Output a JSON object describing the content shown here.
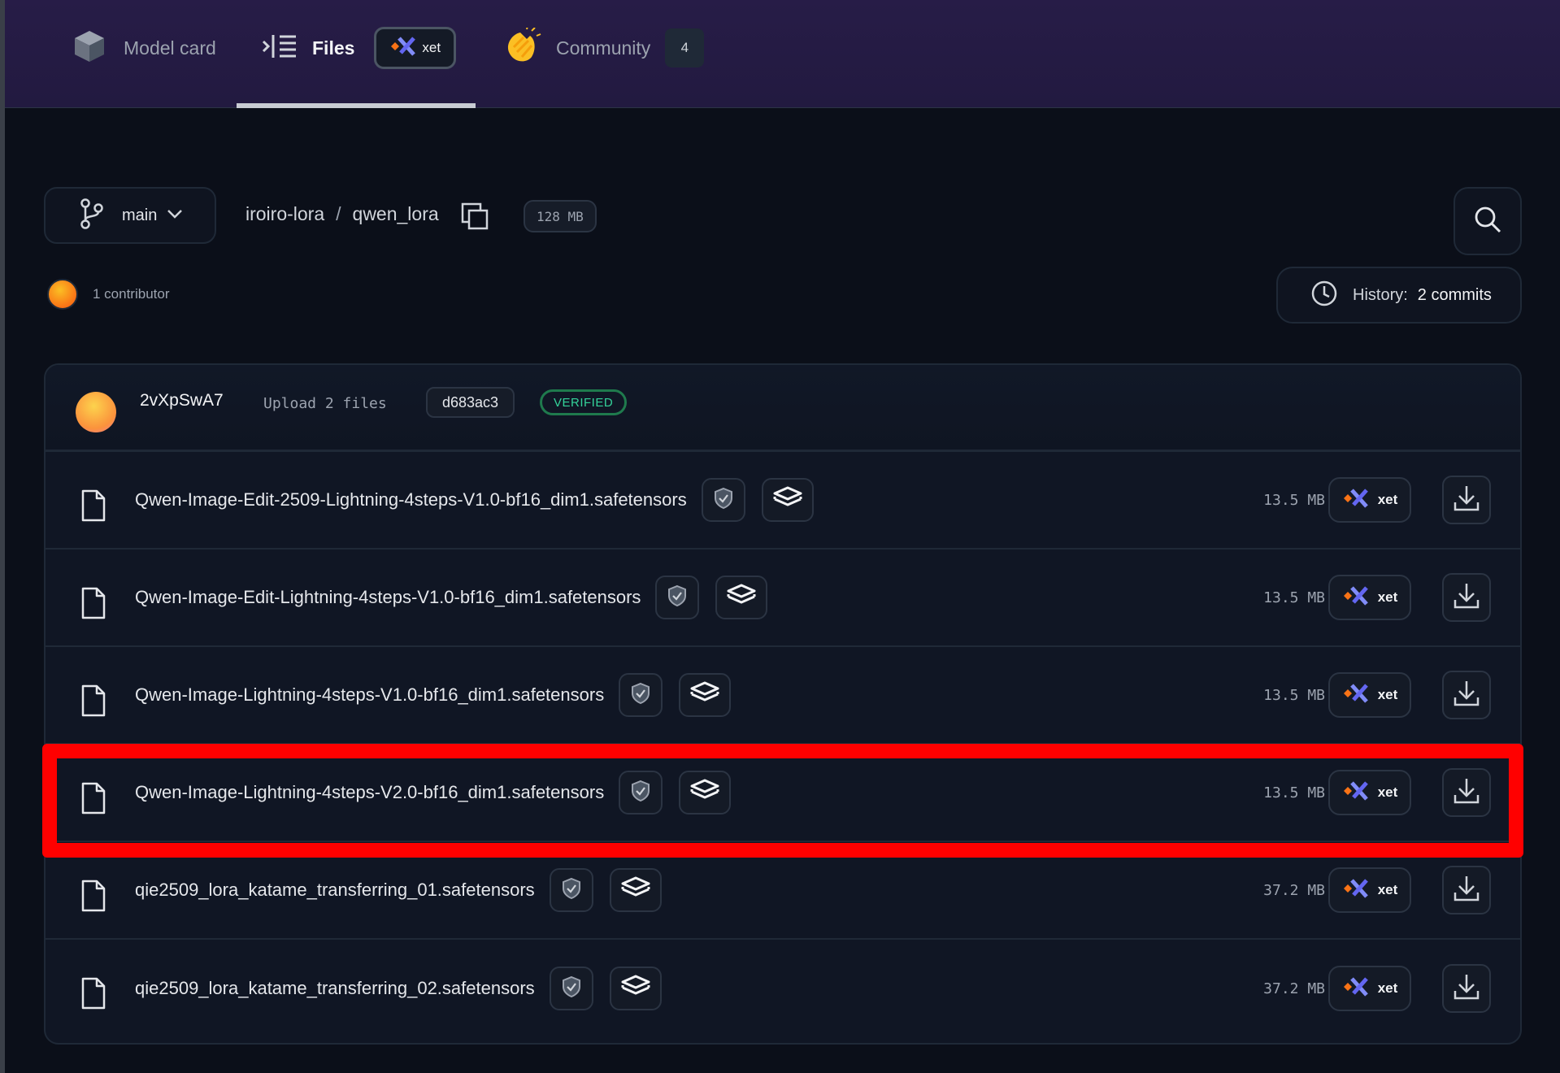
{
  "colors": {
    "background": "#0b0f19",
    "tabbar": "#271c47",
    "accent_orange": "#f97316",
    "accent_purple": "#6366f1",
    "verified": "#34d399",
    "highlight": "#ff0000"
  },
  "tabs": {
    "model_card": {
      "label": "Model card",
      "icon": "cube-icon"
    },
    "files": {
      "label": "Files",
      "icon": "file-list-icon",
      "badge": "xet",
      "active": true
    },
    "community": {
      "label": "Community",
      "icon": "clapping-hands-icon",
      "count": "4"
    }
  },
  "repo": {
    "branch": "main",
    "owner": "iroiro-lora",
    "separator": "/",
    "name": "qwen_lora",
    "size": "128 MB",
    "contributors": "1 contributor",
    "history_label": "History:",
    "history_value": "2 commits"
  },
  "commit": {
    "author": "2vXpSwA7",
    "message": "Upload 2 files",
    "hash": "d683ac3",
    "status": "VERIFIED"
  },
  "files": [
    {
      "name": "Qwen-Image-Edit-2509-Lightning-4steps-V1.0-bf16_dim1.safetensors",
      "size": "13.5 MB",
      "xet": "xet"
    },
    {
      "name": "Qwen-Image-Edit-Lightning-4steps-V1.0-bf16_dim1.safetensors",
      "size": "13.5 MB",
      "xet": "xet"
    },
    {
      "name": "Qwen-Image-Lightning-4steps-V1.0-bf16_dim1.safetensors",
      "size": "13.5 MB",
      "xet": "xet"
    },
    {
      "name": "Qwen-Image-Lightning-4steps-V2.0-bf16_dim1.safetensors",
      "size": "13.5 MB",
      "xet": "xet",
      "highlighted": true
    },
    {
      "name": "qie2509_lora_katame_transferring_01.safetensors",
      "size": "37.2 MB",
      "xet": "xet"
    },
    {
      "name": "qie2509_lora_katame_transferring_02.safetensors",
      "size": "37.2 MB",
      "xet": "xet"
    }
  ]
}
